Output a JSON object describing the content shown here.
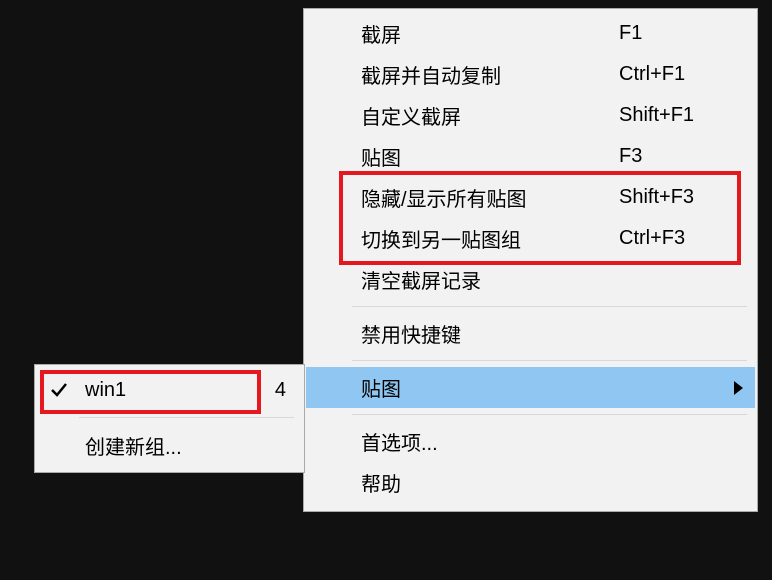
{
  "main_menu": {
    "items": [
      {
        "label": "截屏",
        "shortcut": "F1"
      },
      {
        "label": "截屏并自动复制",
        "shortcut": "Ctrl+F1"
      },
      {
        "label": "自定义截屏",
        "shortcut": "Shift+F1"
      },
      {
        "label": "贴图",
        "shortcut": "F3"
      },
      {
        "label": "隐藏/显示所有贴图",
        "shortcut": "Shift+F3"
      },
      {
        "label": "切换到另一贴图组",
        "shortcut": "Ctrl+F3"
      },
      {
        "label": "清空截屏记录",
        "shortcut": ""
      },
      {
        "label": "禁用快捷键",
        "shortcut": ""
      },
      {
        "label": "贴图",
        "shortcut": "",
        "selected": true,
        "has_submenu": true
      },
      {
        "label": "首选项...",
        "shortcut": ""
      },
      {
        "label": "帮助",
        "shortcut": ""
      }
    ],
    "separators_after": [
      6,
      7,
      8
    ]
  },
  "sub_menu": {
    "items": [
      {
        "label": "win1",
        "count": "4",
        "checked": true
      },
      {
        "label": "创建新组...",
        "count": "",
        "checked": false
      }
    ],
    "separators_after": [
      0
    ]
  },
  "colors": {
    "highlight_red": "#e4181e",
    "selection_blue": "#90c7f2",
    "menu_bg": "#f2f2f2"
  }
}
